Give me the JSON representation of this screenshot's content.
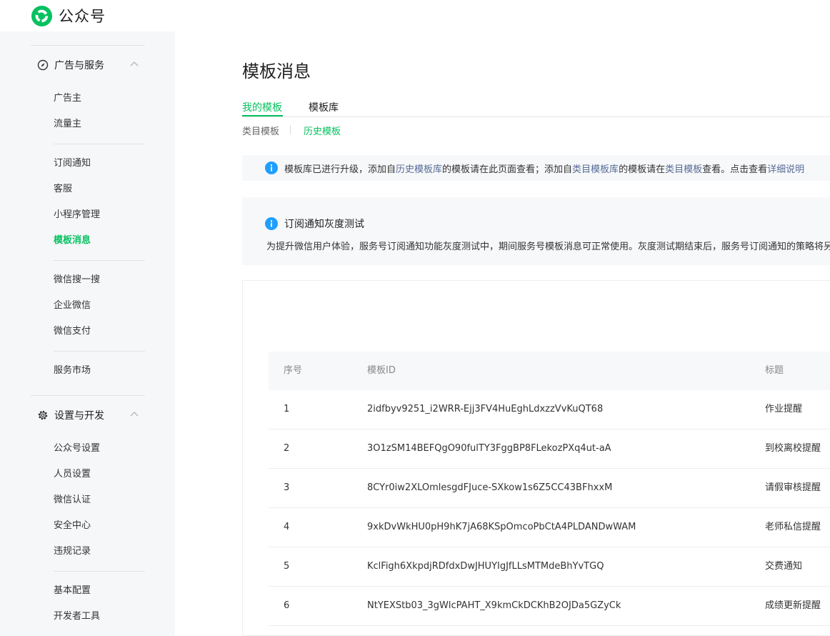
{
  "header": {
    "brand": "公众号",
    "accent_color": "#07c160",
    "logo_icon": "wechat-official-account-logo"
  },
  "sidebar": {
    "sections": [
      {
        "label": "广告与服务",
        "icon": "compass-icon",
        "expanded": true
      },
      {
        "label": "设置与开发",
        "icon": "gear-icon",
        "expanded": true
      }
    ],
    "items": [
      {
        "label": "广告主"
      },
      {
        "label": "流量主"
      },
      {
        "label": "订阅通知"
      },
      {
        "label": "客服"
      },
      {
        "label": "小程序管理"
      },
      {
        "label": "模板消息",
        "active": true
      },
      {
        "label": "微信搜一搜"
      },
      {
        "label": "企业微信"
      },
      {
        "label": "微信支付"
      },
      {
        "label": "服务市场"
      },
      {
        "label": "公众号设置"
      },
      {
        "label": "人员设置"
      },
      {
        "label": "微信认证"
      },
      {
        "label": "安全中心"
      },
      {
        "label": "违规记录"
      },
      {
        "label": "基本配置"
      },
      {
        "label": "开发者工具"
      }
    ]
  },
  "main": {
    "title": "模板消息",
    "tabs": [
      {
        "label": "我的模板",
        "active": true
      },
      {
        "label": "模板库"
      }
    ],
    "subtabs": [
      {
        "label": "类目模板"
      },
      {
        "label": "历史模板",
        "active": true
      }
    ],
    "notice": {
      "t1": "模板库已进行升级，添加自",
      "l1": "历史模板库",
      "t2": "的模板请在此页面查看；添加自",
      "l2": "类目模板库",
      "t3": "的模板请在",
      "l3": "类目模板",
      "t4": "查看。点击查看",
      "l4": "详细说明"
    },
    "gray_test": {
      "title": "订阅通知灰度测试",
      "description": "为提升微信用户体验，服务号订阅通知功能灰度测试中，期间服务号模板消息可正常使用。灰度测试期结束后，服务号订阅通知的策略将另行公"
    },
    "table": {
      "columns": [
        "序号",
        "模板ID",
        "标题"
      ],
      "rows": [
        {
          "index": "1",
          "template_id": "2idfbyv9251_i2WRR-Ejj3FV4HuEghLdxzzVvKuQT68",
          "title": "作业提醒"
        },
        {
          "index": "2",
          "template_id": "3O1zSM14BEFQgO90fulTY3FggBP8FLekozPXq4ut-aA",
          "title": "到校离校提醒"
        },
        {
          "index": "3",
          "template_id": "8CYr0iw2XLOmlesgdFJuce-SXkow1s6Z5CC43BFhxxM",
          "title": "请假审核提醒"
        },
        {
          "index": "4",
          "template_id": "9xkDvWkHU0pH9hK7jA68KSpOmcoPbCtA4PLDANDwWAM",
          "title": "老师私信提醒"
        },
        {
          "index": "5",
          "template_id": "KclFigh6XkpdjRDfdxDwJHUYIgJfLLsMTMdeBhYvTGQ",
          "title": "交费通知"
        },
        {
          "index": "6",
          "template_id": "NtYEXStb03_3gWlcPAHT_X9kmCkDCKhB2OJDa5GZyCk",
          "title": "成绩更新提醒"
        }
      ]
    }
  }
}
